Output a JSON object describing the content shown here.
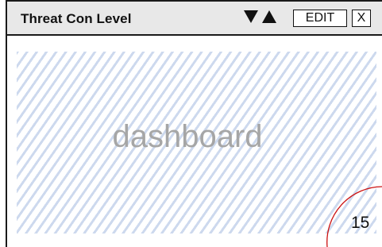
{
  "widget": {
    "title": "Threat Con Level",
    "placeholder": "dashboard",
    "badge_value": "15",
    "badge_color": "#cc1111"
  },
  "toolbar": {
    "move_down_icon": "triangle-down-icon",
    "move_up_icon": "triangle-up-icon",
    "edit_label": "EDIT",
    "close_label": "X"
  },
  "colors": {
    "header_bg": "#e8e8e8",
    "hatch": "#cdd9ee",
    "placeholder_text": "#a6a6a6"
  }
}
